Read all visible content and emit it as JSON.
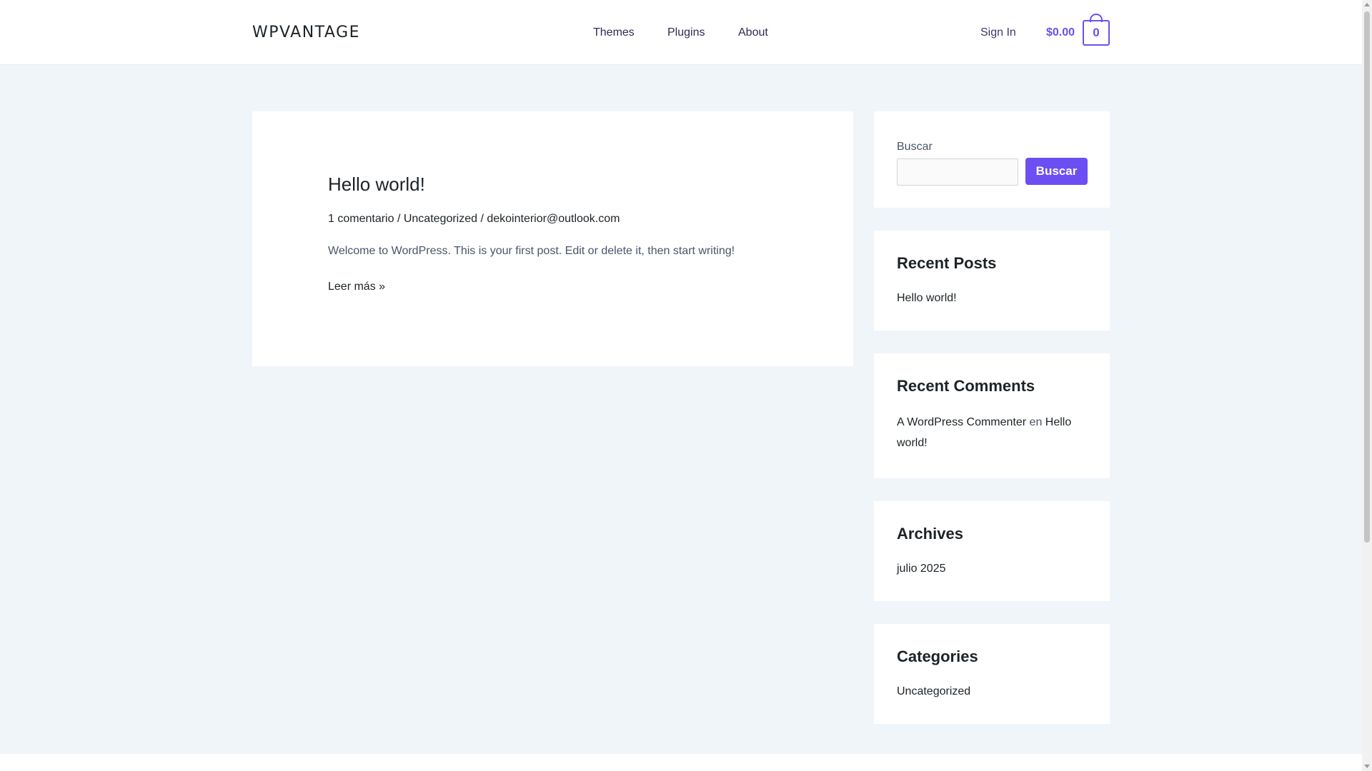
{
  "header": {
    "logo": "WPVANTAGE",
    "nav": [
      {
        "label": "Themes"
      },
      {
        "label": "Plugins"
      },
      {
        "label": "About"
      }
    ],
    "sign_in": "Sign In",
    "cart_total": "$0.00",
    "cart_count": "0"
  },
  "post": {
    "title": "Hello world!",
    "meta_comments": "1 comentario",
    "meta_category": "Uncategorized",
    "meta_author": "dekointerior@outlook.com",
    "separator": "/",
    "excerpt": "Welcome to WordPress. This is your first post. Edit or delete it, then start writing!",
    "read_more": "Leer más »"
  },
  "sidebar": {
    "search": {
      "label": "Buscar",
      "value": "",
      "button": "Buscar"
    },
    "recent_posts": {
      "title": "Recent Posts",
      "items": [
        "Hello world!"
      ]
    },
    "recent_comments": {
      "title": "Recent Comments",
      "author": "A WordPress Commenter",
      "connector": "en",
      "post": "Hello world!"
    },
    "archives": {
      "title": "Archives",
      "items": [
        "julio 2025"
      ]
    },
    "categories": {
      "title": "Categories",
      "items": [
        "Uncategorized"
      ]
    }
  },
  "colors": {
    "accent": "#6c4ff2",
    "background": "#f0f5fa",
    "card": "#ffffff",
    "heading": "#1d2327"
  }
}
